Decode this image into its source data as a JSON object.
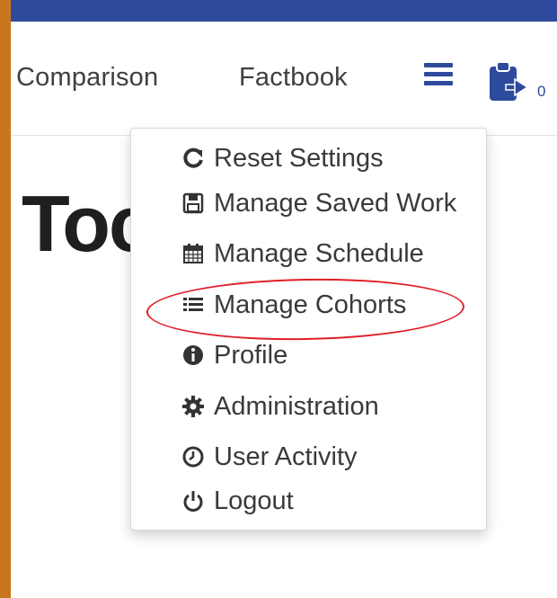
{
  "nav": {
    "comparison_label": "Comparison",
    "factbook_label": "Factbook",
    "clipboard_count": "0"
  },
  "page": {
    "title_partial": "Toc"
  },
  "menu": {
    "items": [
      {
        "label": "Reset Settings",
        "icon": "refresh-icon"
      },
      {
        "label": "Manage Saved Work",
        "icon": "save-icon"
      },
      {
        "label": "Manage Schedule",
        "icon": "calendar-icon"
      },
      {
        "label": "Manage Cohorts",
        "icon": "list-icon"
      },
      {
        "label": "Profile",
        "icon": "info-icon"
      },
      {
        "label": "Administration",
        "icon": "gear-icon"
      },
      {
        "label": "User Activity",
        "icon": "clock-icon"
      },
      {
        "label": "Logout",
        "icon": "power-icon"
      }
    ]
  },
  "colors": {
    "frame": "#c9771f",
    "topbar": "#2d4a9c",
    "annotation": "#e0202a"
  }
}
